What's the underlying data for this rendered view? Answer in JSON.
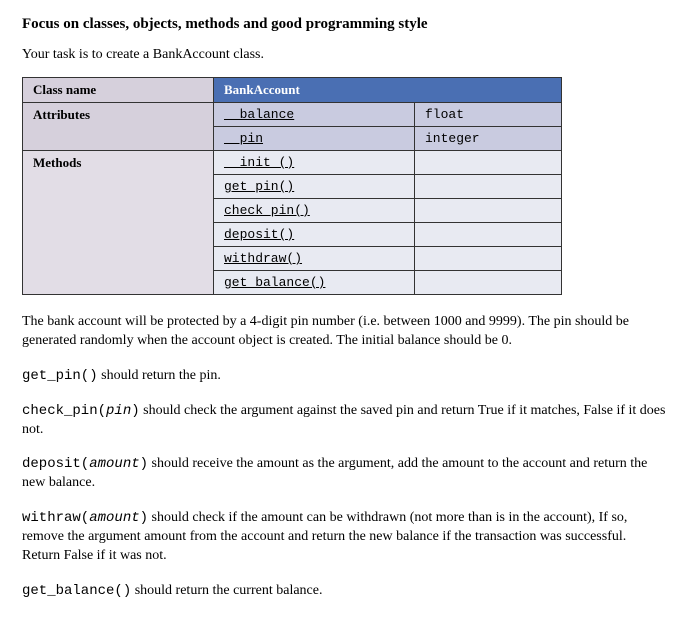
{
  "heading": "Focus on classes, objects, methods and good programming style",
  "intro": "Your task is to create a BankAccount class.",
  "table": {
    "class_label": "Class name",
    "class_value": "BankAccount",
    "attr_label": "Attributes",
    "attrs": [
      {
        "name": "__balance",
        "type": "float"
      },
      {
        "name": "__pin",
        "type": "integer"
      }
    ],
    "method_label": "Methods",
    "methods": [
      "__init_()",
      "get_pin()",
      "check_pin()",
      "deposit()",
      "withdraw()",
      "get_balance()"
    ]
  },
  "para1": "The bank account will be protected by a 4-digit pin number (i.e. between 1000 and 9999). The pin should be generated randomly when the account object is created.  The initial balance should be 0.",
  "p2_code": "get_pin()",
  "p2_rest": " should return the pin.",
  "p3_code": "check_pin(",
  "p3_arg": "pin",
  "p3_code2": ")",
  "p3_rest": " should check the argument against the saved pin and return True if it matches, False if it does not.",
  "p4_code": "deposit(",
  "p4_arg": "amount",
  "p4_code2": ")",
  "p4_rest": " should receive the amount as the argument, add the amount to the account and return the new balance.",
  "p5_code": "withraw(",
  "p5_arg": "amount",
  "p5_code2": ")",
  "p5_rest": " should check if the amount can be withdrawn (not more than is in the account), If so, remove the argument amount from the account and return the new balance if the transaction was successful. Return False if it was not.",
  "p6_code": "get_balance()",
  "p6_rest": " should return the current balance."
}
